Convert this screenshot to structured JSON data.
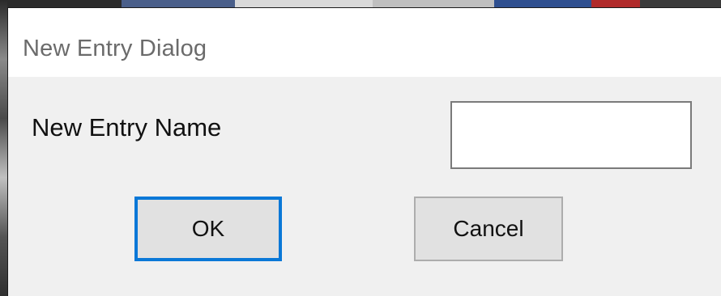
{
  "window": {
    "title": "New Entry Dialog"
  },
  "form": {
    "name_label": "New Entry Name",
    "name_value": ""
  },
  "buttons": {
    "ok_label": "OK",
    "cancel_label": "Cancel"
  },
  "colors": {
    "dialog_background": "#f0f0f0",
    "titlebar_background": "#ffffff",
    "focus_border": "#0a78d7",
    "button_face": "#e1e1e1"
  }
}
